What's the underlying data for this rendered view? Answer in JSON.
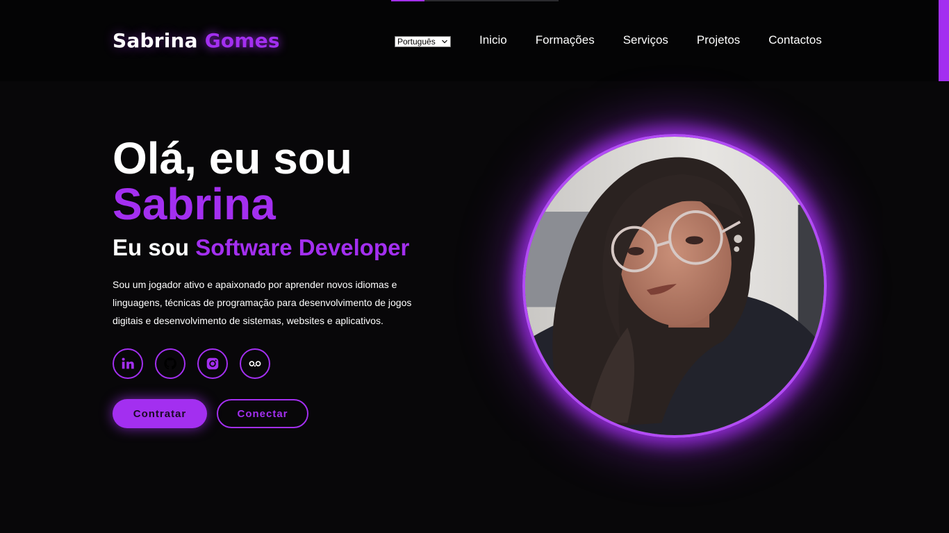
{
  "brand": {
    "first": "Sabrina",
    "last": "Gomes"
  },
  "header": {
    "language": "Português",
    "nav": [
      "Inicio",
      "Formações",
      "Serviços",
      "Projetos",
      "Contactos"
    ]
  },
  "hero": {
    "greeting": "Olá, eu sou",
    "name": "Sabrina",
    "role_prefix": "Eu sou",
    "role": "Software Developer",
    "description": "Sou um jogador ativo e apaixonado por aprender novos idiomas e linguagens, técnicas de programação para desenvolvimento de jogos digitais e desenvolvimento de sistemas, websites e aplicativos.",
    "socials": [
      "linkedin-icon",
      "github-icon",
      "instagram-icon",
      "flickr-icon"
    ],
    "buttons": {
      "primary": "Contratar",
      "secondary": "Conectar"
    }
  },
  "scroll_progress": 0.2,
  "colors": {
    "accent": "#a32ff0",
    "background": "#080709",
    "header": "#040405"
  }
}
